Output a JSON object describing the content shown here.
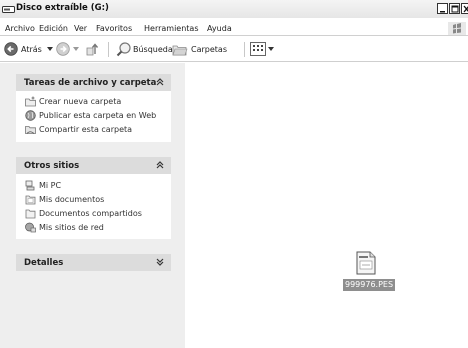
{
  "window": {
    "title": "Disco extraíble (G:)"
  },
  "menubar": {
    "items": [
      "Archivo",
      "Edición",
      "Ver",
      "Favoritos",
      "Herramientas",
      "Ayuda"
    ]
  },
  "toolbar": {
    "back_label": "Atrás",
    "search_label": "Búsqueda",
    "folders_label": "Carpetas"
  },
  "tasks_panel": {
    "title": "Tareas de archivo y carpeta",
    "items": [
      "Crear nueva carpeta",
      "Publicar esta carpeta en Web",
      "Compartir esta carpeta"
    ]
  },
  "other_places_panel": {
    "title": "Otros sitios",
    "items": [
      "Mi PC",
      "Mis documentos",
      "Documentos compartidos",
      "Mis sitios de red"
    ]
  },
  "details_panel": {
    "title": "Detalles"
  },
  "files": [
    {
      "name": "999976.PES",
      "icon": "pes-file-icon",
      "selected": true
    }
  ],
  "colors": {
    "selection": "#8e8e8e",
    "pane_background": "#eeeeee",
    "panel_header": "#dcdcdc"
  }
}
